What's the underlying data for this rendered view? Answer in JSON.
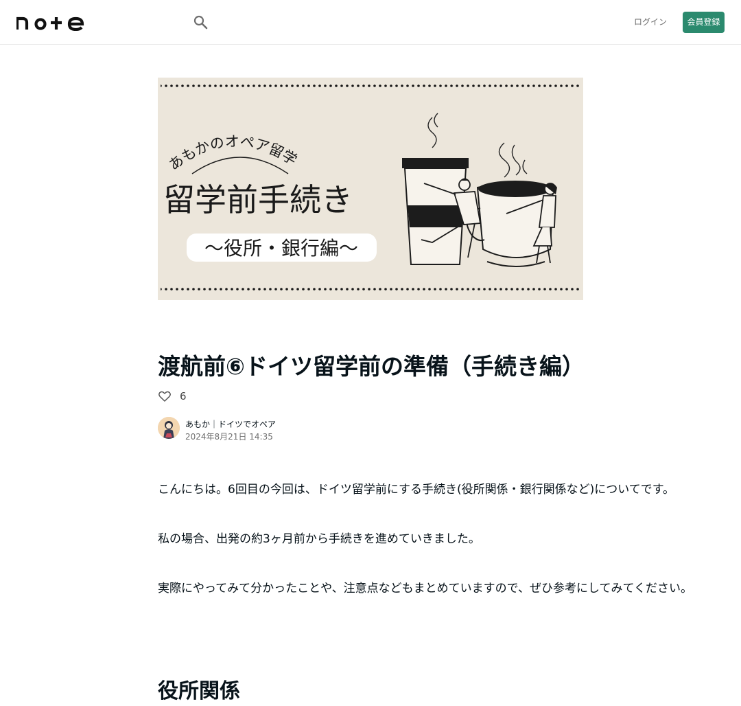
{
  "header": {
    "logo_text": "note",
    "login_label": "ログイン",
    "signup_label": "会員登録"
  },
  "hero": {
    "arc_text": "あもかのオペア留学",
    "main_text": "留学前手続き",
    "sub_text": "〜役所・銀行編〜"
  },
  "article": {
    "title": "渡航前⑥ドイツ留学前の準備（手続き編）",
    "like_count": "6",
    "author_name": "あもか｜ドイツでオペア",
    "post_date": "2024年8月21日 14:35",
    "paragraphs": [
      "こんにちは。6回目の今回は、ドイツ留学前にする手続き(役所関係・銀行関係など)についてです。",
      "私の場合、出発の約3ヶ月前から手続きを進めていきました。",
      "実際にやってみて分かったことや、注意点などもまとめていますので、ぜひ参考にしてみてください。"
    ],
    "section_heading": "役所関係"
  },
  "colors": {
    "brand_green": "#2b8a6e",
    "text": "#08131a",
    "hero_bg": "#ece6db"
  }
}
